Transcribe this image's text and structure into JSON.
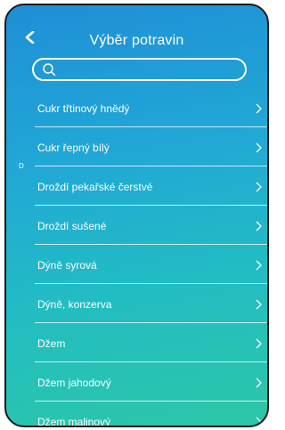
{
  "header": {
    "title": "Výběr potravin"
  },
  "search": {
    "value": "",
    "placeholder": ""
  },
  "index_letter": "D",
  "items": [
    {
      "label": "Cukr třtinový hnědý"
    },
    {
      "label": "Cukr řepný bílý"
    },
    {
      "label": "Droždí pekařské čerstvé"
    },
    {
      "label": "Droždí sušené"
    },
    {
      "label": "Dýně syrová"
    },
    {
      "label": "Dýně, konzerva"
    },
    {
      "label": "Džem"
    },
    {
      "label": "Džem jahodový"
    },
    {
      "label": "Džem malinový"
    }
  ],
  "colors": {
    "gradient_top": "#1f8fd6",
    "gradient_bottom": "#2cc7a7",
    "text": "#ffffff"
  },
  "icons": {
    "back": "chevron-left-icon",
    "search": "search-icon",
    "row": "chevron-right-icon"
  }
}
